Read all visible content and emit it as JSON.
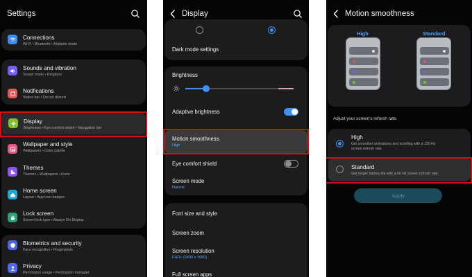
{
  "settings": {
    "title": "Settings",
    "items": [
      {
        "label": "Connections",
        "sub": "Wi-Fi  •  Bluetooth  •  Airplane mode",
        "color": "#3b8bf5",
        "icon": "wifi-icon"
      },
      {
        "label": "Sounds and vibration",
        "sub": "Sound mode  •  Ringtone",
        "color": "#7a5af5",
        "icon": "speaker-icon"
      },
      {
        "label": "Notifications",
        "sub": "Status bar  •  Do not disturb",
        "color": "#e5574f",
        "icon": "bell-icon"
      },
      {
        "label": "Display",
        "sub": "Brightness  •  Eye comfort shield  •  Navigation bar",
        "color": "#7fc127",
        "icon": "sun-icon"
      },
      {
        "label": "Wallpaper and style",
        "sub": "Wallpapers  •  Color palette",
        "color": "#e35a86",
        "icon": "image-icon"
      },
      {
        "label": "Themes",
        "sub": "Themes  •  Wallpapers  •  Icons",
        "color": "#8e56e8",
        "icon": "palette-icon"
      },
      {
        "label": "Home screen",
        "sub": "Layout  •  App icon badges",
        "color": "#23a9d6",
        "icon": "home-icon"
      },
      {
        "label": "Lock screen",
        "sub": "Screen lock type  •  Always On Display",
        "color": "#2ba07a",
        "icon": "lock-icon"
      },
      {
        "label": "Biometrics and security",
        "sub": "Face recognition  •  Fingerprints",
        "color": "#4b64e0",
        "icon": "shield-icon"
      },
      {
        "label": "Privacy",
        "sub": "Permission usage  •  Permission manager",
        "color": "#4f6be8",
        "icon": "privacy-icon"
      }
    ]
  },
  "display": {
    "title": "Display",
    "dark_mode_settings": "Dark mode settings",
    "brightness": "Brightness",
    "brightness_level": 0.2,
    "adaptive_brightness": "Adaptive brightness",
    "adaptive_on": true,
    "motion_smoothness": "Motion smoothness",
    "motion_value": "High",
    "eye_comfort": "Eye comfort shield",
    "eye_comfort_on": false,
    "screen_mode": "Screen mode",
    "screen_mode_value": "Natural",
    "font_size": "Font size and style",
    "screen_zoom": "Screen zoom",
    "screen_resolution": "Screen resolution",
    "screen_resolution_value": "FHD+ (2400 x 1080)",
    "full_screen_apps": "Full screen apps"
  },
  "motion": {
    "title": "Motion smoothness",
    "high_label": "High",
    "standard_label": "Standard",
    "caption": "Adjust your screen's refresh rate.",
    "options": [
      {
        "label": "High",
        "desc1": "Get smoother animations and scrolling with a 120 Hz",
        "desc2": "screen refresh rate.",
        "selected": true
      },
      {
        "label": "Standard",
        "desc1": "Get longer battery life with a 60 Hz screen refresh rate.",
        "desc2": "",
        "selected": false
      }
    ],
    "apply": "Apply"
  },
  "colors": {
    "accent": "#3e91f7",
    "highlight": "#d30f12",
    "card": "#1c1c1e",
    "toggle_on": "#3e91f7"
  }
}
